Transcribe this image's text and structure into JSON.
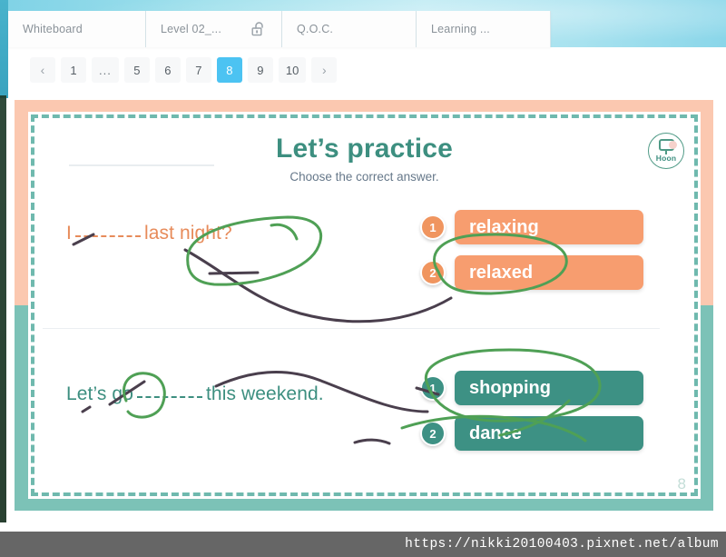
{
  "window": {
    "background_accent": "#8ad6e9",
    "left_strip_color": "#3fa9c4"
  },
  "tabs": [
    {
      "label": "Whiteboard",
      "icon": "",
      "active": false
    },
    {
      "label": "Level 02_...",
      "icon": "unlock-icon",
      "active": false
    },
    {
      "label": "Q.O.C.",
      "icon": "",
      "active": false
    },
    {
      "label": "Learning ...",
      "icon": "",
      "active": false
    }
  ],
  "pagination": {
    "prev_label": "‹",
    "next_label": "›",
    "ellipsis": "...",
    "pages": [
      "1",
      "...",
      "5",
      "6",
      "7",
      "8",
      "9",
      "10"
    ],
    "current": "8",
    "active_color": "#4cc3f2"
  },
  "slide": {
    "title": "Let’s practice",
    "subtitle": "Choose the correct answer.",
    "page_number": "8",
    "logo": {
      "text": "Hoon",
      "name": "hoon-logo"
    },
    "border_top_color": "#fbc8b0",
    "border_bottom_color": "#7cc2b7",
    "dashed_border_color": "#6fb9ae",
    "questions": [
      {
        "prefix": "I",
        "suffix": "last night?",
        "color": "#e78b5a",
        "answers": [
          {
            "number": "1",
            "label": "relaxing"
          },
          {
            "number": "2",
            "label": "relaxed"
          }
        ]
      },
      {
        "prefix": "Let’s go",
        "suffix": "this weekend.",
        "color": "#3d8f80",
        "answers": [
          {
            "number": "1",
            "label": "shopping"
          },
          {
            "number": "2",
            "label": "dance"
          }
        ]
      }
    ],
    "annotations": {
      "ink_green": "#4fa055",
      "ink_dark": "#4a3f4d",
      "circled_items": [
        "last night?",
        "relaxed",
        "go",
        "shopping"
      ]
    }
  },
  "watermark": {
    "url": "https://nikki20100403.pixnet.net/album"
  }
}
